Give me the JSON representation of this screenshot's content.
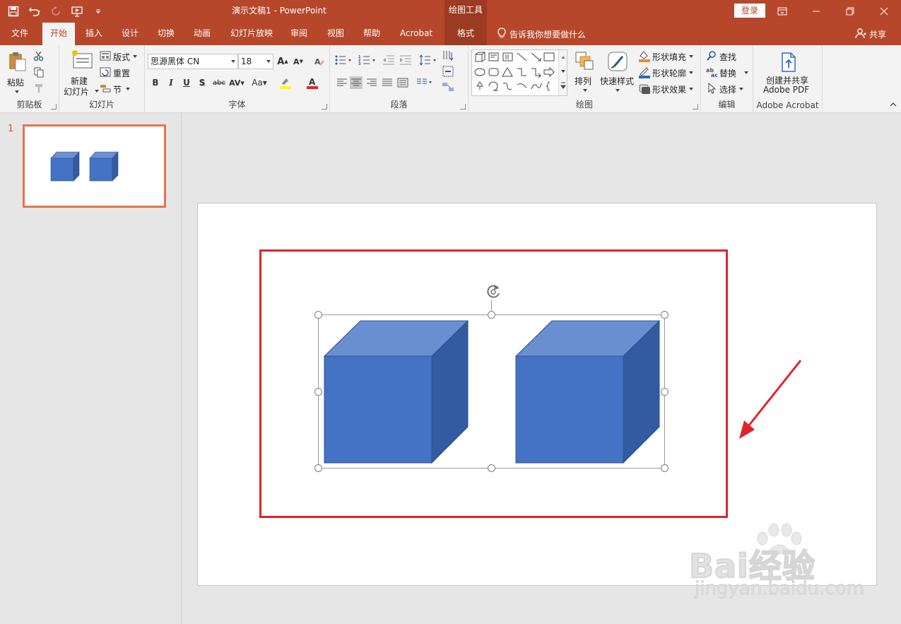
{
  "window": {
    "title": "演示文稿1  -  PowerPoint",
    "context_tool": "绘图工具",
    "login": "登录"
  },
  "tabs": [
    {
      "label": "文件",
      "active": false
    },
    {
      "label": "开始",
      "active": true
    },
    {
      "label": "插入",
      "active": false
    },
    {
      "label": "设计",
      "active": false
    },
    {
      "label": "切换",
      "active": false
    },
    {
      "label": "动画",
      "active": false
    },
    {
      "label": "幻灯片放映",
      "active": false
    },
    {
      "label": "审阅",
      "active": false
    },
    {
      "label": "视图",
      "active": false
    },
    {
      "label": "帮助",
      "active": false
    },
    {
      "label": "Acrobat",
      "active": false
    },
    {
      "label": "格式",
      "active": false
    }
  ],
  "tellme": "告诉我你想要做什么",
  "share": "共享",
  "ribbon": {
    "clipboard": {
      "label": "剪贴板",
      "paste": "粘贴"
    },
    "slides": {
      "label": "幻灯片",
      "new_slide_1": "新建",
      "new_slide_2": "幻灯片",
      "layout": "版式",
      "reset": "重置",
      "section": "节"
    },
    "font": {
      "label": "字体",
      "font_name": "思源黑体 CN",
      "font_size": "18"
    },
    "paragraph": {
      "label": "段落"
    },
    "drawing": {
      "label": "绘图",
      "arrange": "排列",
      "quick_styles": "快速样式",
      "shape_fill": "形状填充",
      "shape_outline": "形状轮廓",
      "shape_effects": "形状效果"
    },
    "editing": {
      "label": "编辑",
      "find": "查找",
      "replace": "替换",
      "select": "选择"
    },
    "acrobat": {
      "label": "Adobe Acrobat",
      "create_1": "创建并共享",
      "create_2": "Adobe PDF"
    }
  },
  "slides_pane": {
    "slide_number": "1"
  },
  "watermark": {
    "brand": "Bai经验",
    "url": "jingyan.baidu.com"
  },
  "colors": {
    "accent": "#b7472a",
    "cube_front": "#4472c4",
    "cube_top": "#6a8fd0",
    "cube_side": "#335ba1",
    "annotation_red": "#e0232b"
  }
}
